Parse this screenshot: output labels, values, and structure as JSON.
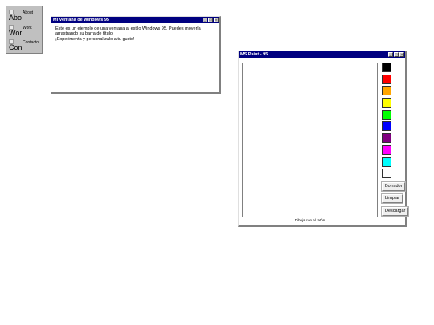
{
  "desktop_icons": [
    {
      "alt": "Abo",
      "label": "About"
    },
    {
      "alt": "Wor",
      "label": "Work"
    },
    {
      "alt": "Con",
      "label": "Contacto"
    }
  ],
  "welcome_window": {
    "title": "Mi Ventana de Windows 95",
    "controls": [
      "_",
      "□",
      "×"
    ],
    "body_lines": [
      "Este es un ejemplo de una ventana al estilo Windows 95. Puedes moverla",
      "arrastrando su barra de título.",
      "¡Experimenta y personalízalo a tu gusto!"
    ]
  },
  "paint_window": {
    "title": "MS Paint - 95",
    "controls": [
      "_",
      "□",
      "×"
    ],
    "canvas_caption": "Dibuja con el ratón",
    "palette": [
      {
        "name": "black",
        "color": "#000000"
      },
      {
        "name": "red",
        "color": "#ff0000"
      },
      {
        "name": "orange",
        "color": "#ffa500"
      },
      {
        "name": "yellow",
        "color": "#ffff00"
      },
      {
        "name": "green",
        "color": "#00ff00"
      },
      {
        "name": "blue",
        "color": "#0000ff"
      },
      {
        "name": "purple",
        "color": "#800080"
      },
      {
        "name": "magenta",
        "color": "#ff00ff"
      },
      {
        "name": "cyan",
        "color": "#00ffff"
      },
      {
        "name": "white",
        "color": "#ffffff"
      }
    ],
    "tools": {
      "eraser_label": "Borrador",
      "clear_label": "Limpiar",
      "download_label": "Descargar"
    }
  },
  "colors": {
    "titlebar": "#000080",
    "face": "#c0c0c0"
  }
}
